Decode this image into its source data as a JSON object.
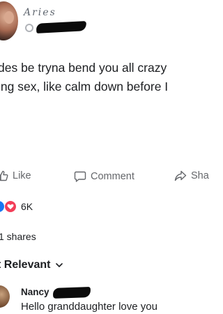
{
  "post": {
    "author_name": "Aries",
    "text_line_1": "des be tryna bend you all crazy",
    "text_line_2": "ing sex, like calm down before I"
  },
  "actions": {
    "like_label": "Like",
    "comment_label": "Comment",
    "share_label": "Sha"
  },
  "reactions": {
    "count": "6K",
    "icons": [
      "like-icon",
      "love-icon"
    ]
  },
  "shares": {
    "label": "1 shares"
  },
  "comments_sort": {
    "label": "t Relevant"
  },
  "comments": [
    {
      "author": "Nancy",
      "text": "Hello granddaughter love you"
    }
  ],
  "colors": {
    "text": "#1c1e21",
    "secondary": "#65676b",
    "like_blue": "#1877f2",
    "love_red": "#f33e58"
  }
}
